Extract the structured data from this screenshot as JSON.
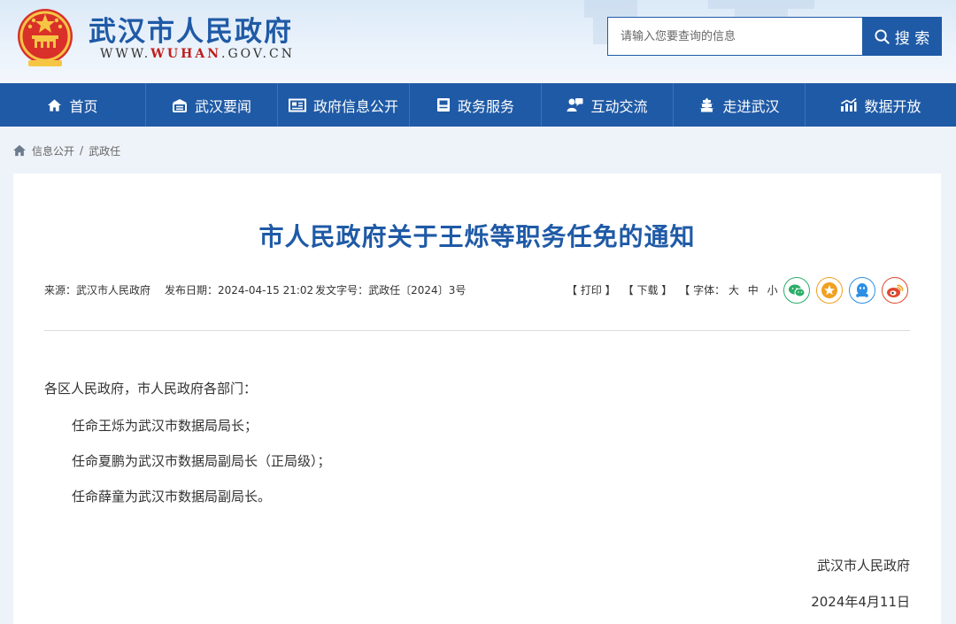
{
  "header": {
    "site_title": "武汉市人民政府",
    "url_prefix": "WWW.",
    "url_highlight": "WUHAN",
    "url_suffix": ".GOV.CN",
    "search_placeholder": "请输入您要查询的信息",
    "search_label": "搜 索",
    "search_icon": "search-icon"
  },
  "nav": {
    "items": [
      {
        "label": "首页",
        "icon": "home-icon"
      },
      {
        "label": "武汉要闻",
        "icon": "news-icon"
      },
      {
        "label": "政府信息公开",
        "icon": "info-disclosure-icon"
      },
      {
        "label": "政务服务",
        "icon": "service-icon"
      },
      {
        "label": "互动交流",
        "icon": "interaction-icon"
      },
      {
        "label": "走进武汉",
        "icon": "city-icon"
      },
      {
        "label": "数据开放",
        "icon": "data-chart-icon"
      }
    ]
  },
  "breadcrumb": {
    "home_icon": "home-icon",
    "items": [
      "信息公开",
      "武政任"
    ],
    "separator": "/"
  },
  "article": {
    "title": "市人民政府关于王烁等职务任免的通知",
    "source": "来源：武汉市人民政府",
    "date": "发布日期：2024-04-15 21:02",
    "doc_number": "发文字号：武政任〔2024〕3号",
    "print_label": "【 打印 】",
    "download_label": "【 下载 】",
    "font_label": "【 字体：",
    "font_large": "大",
    "font_medium": "中",
    "font_small": "小",
    "font_end": "】",
    "share": [
      "wechat-icon",
      "favorite-icon",
      "qq-icon",
      "weibo-icon"
    ],
    "salutation": "各区人民政府，市人民政府各部门：",
    "paragraphs": [
      "任命王烁为武汉市数据局局长；",
      "任命夏鹏为武汉市数据局副局长（正局级）；",
      "任命薛童为武汉市数据局副局长。"
    ],
    "signature": "武汉市人民政府",
    "sign_date": "2024年4月11日"
  },
  "colors": {
    "brand_blue": "#1f5aa6",
    "url_red": "#c01e1e",
    "wechat": "#2aae67",
    "favorite": "#f0a020",
    "qq": "#2b8fe6",
    "weibo": "#e0482e"
  }
}
